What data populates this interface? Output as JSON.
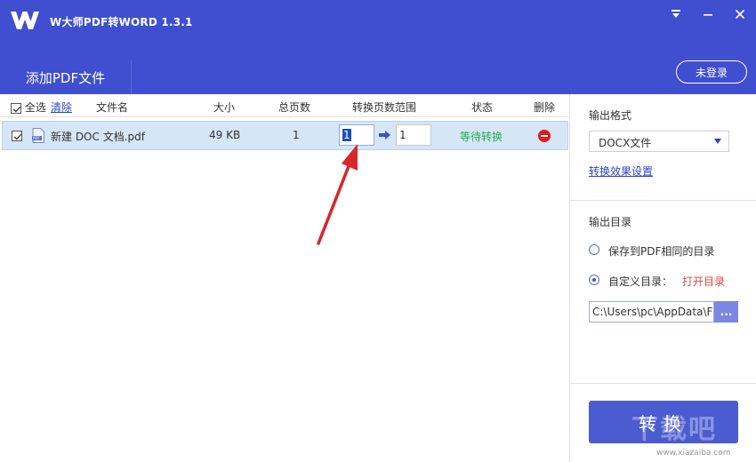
{
  "app": {
    "title": "W大师PDF转WORD 1.3.1",
    "colors": {
      "brand": "#3f4fcf",
      "status_waiting": "#1fae4a",
      "delete": "#e01b1b",
      "link": "#2d45c7"
    }
  },
  "toolbar": {
    "add_file_label": "添加PDF文件",
    "login_label": "未登录"
  },
  "table": {
    "select_all": "全选",
    "clear": "清除",
    "headers": {
      "filename": "文件名",
      "size": "大小",
      "pages": "总页数",
      "range": "转换页数范围",
      "status": "状态",
      "delete": "删除"
    },
    "rows": [
      {
        "filename": "新建 DOC 文档.pdf",
        "size": "49 KB",
        "pages": "1",
        "range_start": "1",
        "range_end": "1",
        "status": "等待转换",
        "checked": true
      }
    ]
  },
  "side": {
    "output_format_label": "输出格式",
    "format_value": "DOCX文件",
    "effect_settings": "转换效果设置",
    "output_dir_label": "输出目录",
    "option_same_dir": "保存到PDF相同的目录",
    "option_custom_dir": "自定义目录：",
    "open_dir": "打开目录",
    "path_value": "C:\\Users\\pc\\AppData\\F",
    "browse_label": "...",
    "convert_label": "转换"
  },
  "watermark": {
    "text": "下载吧",
    "url": "www.xiazaiba.com"
  }
}
